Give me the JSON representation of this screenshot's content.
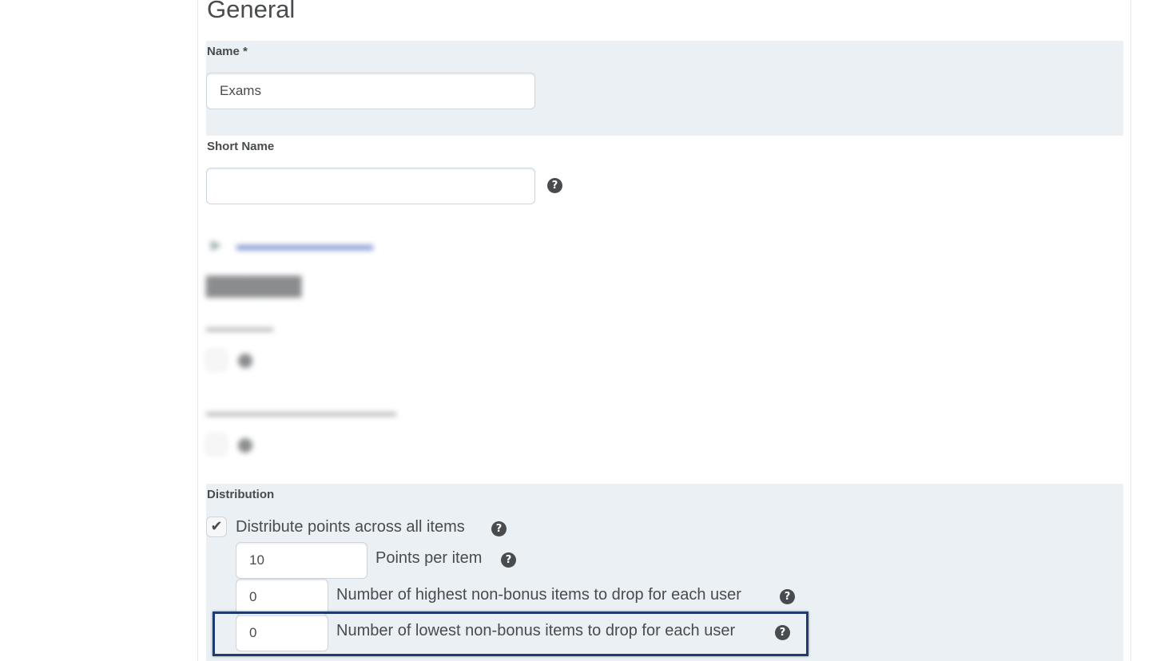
{
  "section_title": "General",
  "name_field": {
    "label": "Name *",
    "value": "Exams"
  },
  "short_name_field": {
    "label": "Short Name",
    "value": "",
    "help_icon": "help-icon"
  },
  "distribution": {
    "label": "Distribution",
    "distribute_checkbox": {
      "label": "Distribute points across all items",
      "checked": true
    },
    "points_per_item": {
      "value": "10",
      "label": "Points per item"
    },
    "drop_highest": {
      "value": "0",
      "label": "Number of highest non-bonus items to drop for each user"
    },
    "drop_lowest": {
      "value": "0",
      "label": "Number of lowest non-bonus items to drop for each user"
    }
  },
  "highlight_color": "#1f3a6e",
  "band_color": "#eaf0f3"
}
